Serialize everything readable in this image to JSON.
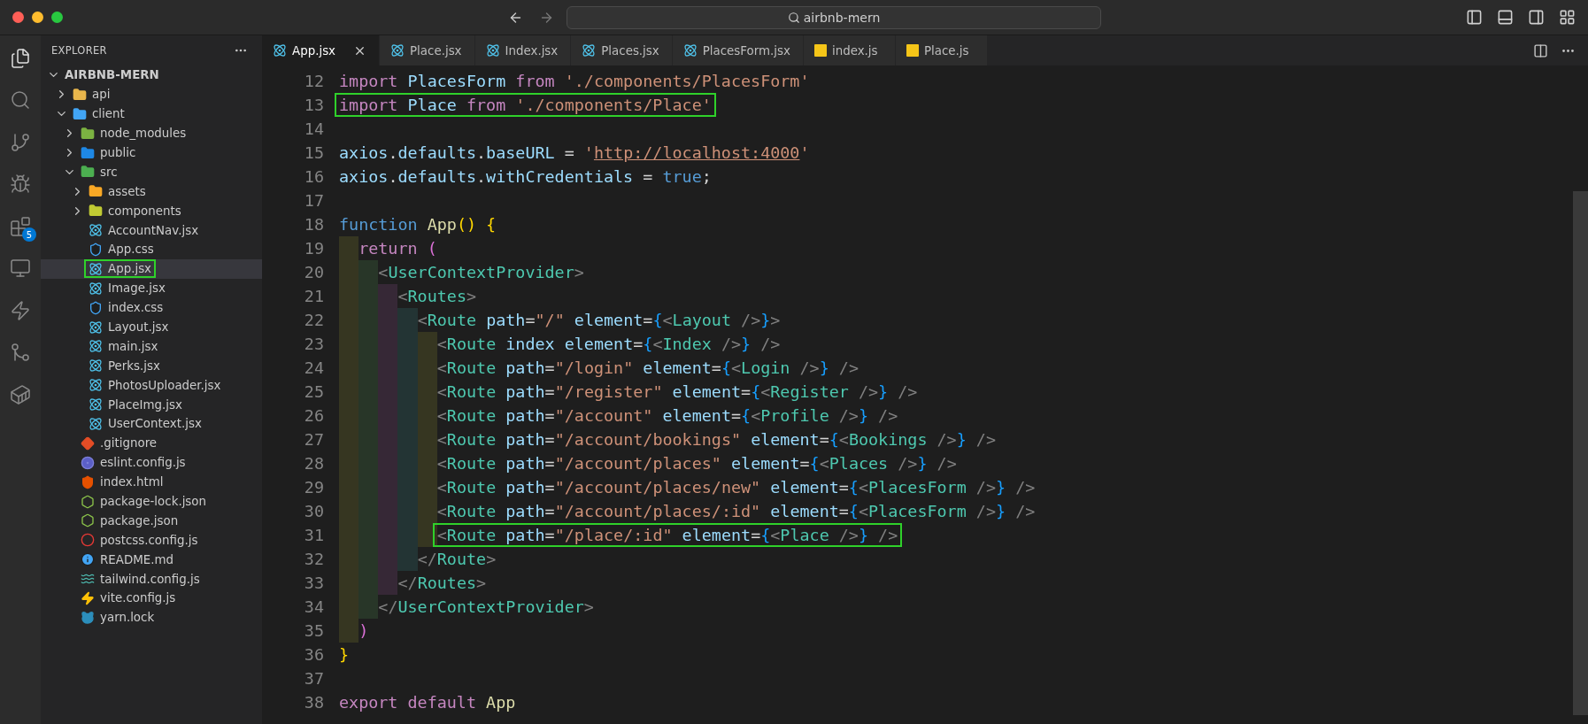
{
  "window": {
    "title": "airbnb-mern"
  },
  "activity_bar": [
    {
      "kind": "files",
      "selected": true
    },
    {
      "kind": "search",
      "selected": false
    },
    {
      "kind": "branch",
      "selected": false
    },
    {
      "kind": "debug",
      "selected": false
    },
    {
      "kind": "extensions",
      "selected": false,
      "badge": "5"
    },
    {
      "kind": "remote",
      "selected": false
    },
    {
      "kind": "lightning",
      "selected": false
    },
    {
      "kind": "merge",
      "selected": false
    },
    {
      "kind": "container",
      "selected": false
    }
  ],
  "explorer": {
    "title": "EXPLORER",
    "tree": [
      {
        "label": "AIRBNB-MERN",
        "kind": "root",
        "expanded": true,
        "selected": false,
        "boxed": false,
        "children": [
          {
            "label": "api",
            "kind": "folder",
            "color": "#e8b64c",
            "expanded": false,
            "selected": false,
            "boxed": false
          },
          {
            "label": "client",
            "kind": "folder",
            "color": "#42a5f5",
            "expanded": true,
            "selected": false,
            "boxed": false,
            "children": [
              {
                "label": "node_modules",
                "kind": "folder",
                "color": "#7cb342",
                "expanded": false,
                "selected": false,
                "boxed": false
              },
              {
                "label": "public",
                "kind": "folder",
                "color": "#1e88e5",
                "expanded": false,
                "selected": false,
                "boxed": false
              },
              {
                "label": "src",
                "kind": "folder",
                "color": "#4caf50",
                "expanded": true,
                "selected": false,
                "boxed": false,
                "children": [
                  {
                    "label": "assets",
                    "kind": "folder",
                    "color": "#f9a825",
                    "expanded": false,
                    "selected": false,
                    "boxed": false
                  },
                  {
                    "label": "components",
                    "kind": "folder",
                    "color": "#c0ca33",
                    "expanded": false,
                    "selected": false,
                    "boxed": false
                  },
                  {
                    "label": "AccountNav.jsx",
                    "kind": "react",
                    "selected": false,
                    "boxed": false
                  },
                  {
                    "label": "App.css",
                    "kind": "css",
                    "selected": false,
                    "boxed": false
                  },
                  {
                    "label": "App.jsx",
                    "kind": "react",
                    "selected": true,
                    "boxed": true
                  },
                  {
                    "label": "Image.jsx",
                    "kind": "react",
                    "selected": false,
                    "boxed": false
                  },
                  {
                    "label": "index.css",
                    "kind": "css",
                    "selected": false,
                    "boxed": false
                  },
                  {
                    "label": "Layout.jsx",
                    "kind": "react",
                    "selected": false,
                    "boxed": false
                  },
                  {
                    "label": "main.jsx",
                    "kind": "react",
                    "selected": false,
                    "boxed": false
                  },
                  {
                    "label": "Perks.jsx",
                    "kind": "react",
                    "selected": false,
                    "boxed": false
                  },
                  {
                    "label": "PhotosUploader.jsx",
                    "kind": "react",
                    "selected": false,
                    "boxed": false
                  },
                  {
                    "label": "PlaceImg.jsx",
                    "kind": "react",
                    "selected": false,
                    "boxed": false
                  },
                  {
                    "label": "UserContext.jsx",
                    "kind": "react",
                    "selected": false,
                    "boxed": false
                  }
                ]
              },
              {
                "label": ".gitignore",
                "kind": "git",
                "selected": false,
                "boxed": false
              },
              {
                "label": "eslint.config.js",
                "kind": "eslint",
                "selected": false,
                "boxed": false
              },
              {
                "label": "index.html",
                "kind": "html",
                "selected": false,
                "boxed": false
              },
              {
                "label": "package-lock.json",
                "kind": "json",
                "selected": false,
                "boxed": false
              },
              {
                "label": "package.json",
                "kind": "json",
                "selected": false,
                "boxed": false
              },
              {
                "label": "postcss.config.js",
                "kind": "postcss",
                "selected": false,
                "boxed": false
              },
              {
                "label": "README.md",
                "kind": "readme",
                "selected": false,
                "boxed": false
              },
              {
                "label": "tailwind.config.js",
                "kind": "tailwind",
                "selected": false,
                "boxed": false
              },
              {
                "label": "vite.config.js",
                "kind": "vite",
                "selected": false,
                "boxed": false
              },
              {
                "label": "yarn.lock",
                "kind": "yarn",
                "selected": false,
                "boxed": false
              }
            ]
          }
        ]
      }
    ]
  },
  "tabs": [
    {
      "label": "App.jsx",
      "kind": "react",
      "selected": true
    },
    {
      "label": "Place.jsx",
      "kind": "react",
      "selected": false
    },
    {
      "label": "Index.jsx",
      "kind": "react",
      "selected": false
    },
    {
      "label": "Places.jsx",
      "kind": "react",
      "selected": false
    },
    {
      "label": "PlacesForm.jsx",
      "kind": "react",
      "selected": false
    },
    {
      "label": "index.js",
      "kind": "js",
      "selected": false
    },
    {
      "label": "Place.js",
      "kind": "js",
      "selected": false
    }
  ],
  "editor": {
    "lines": [
      {
        "number": "12",
        "boxed": false,
        "tokens": [
          {
            "kind": "kw",
            "text": "import "
          },
          {
            "kind": "var",
            "text": "PlacesForm "
          },
          {
            "kind": "kw",
            "text": "from "
          },
          {
            "kind": "str",
            "text": "'./components/PlacesForm'"
          }
        ]
      },
      {
        "number": "13",
        "boxed": true,
        "tokens": [
          {
            "kind": "kw",
            "text": "import "
          },
          {
            "kind": "var",
            "text": "Place "
          },
          {
            "kind": "kw",
            "text": "from "
          },
          {
            "kind": "str",
            "text": "'./components/Place'"
          }
        ]
      },
      {
        "number": "14"
      },
      {
        "number": "15",
        "boxed": false,
        "tokens": [
          {
            "kind": "var",
            "text": "axios"
          },
          {
            "kind": "p",
            "text": "."
          },
          {
            "kind": "var",
            "text": "defaults"
          },
          {
            "kind": "p",
            "text": "."
          },
          {
            "kind": "var",
            "text": "baseURL"
          },
          {
            "kind": "p",
            "text": " = "
          },
          {
            "kind": "str",
            "text": "'"
          },
          {
            "kind": "link",
            "text": "http://localhost:4000"
          },
          {
            "kind": "str",
            "text": "'"
          }
        ]
      },
      {
        "number": "16",
        "boxed": false,
        "tokens": [
          {
            "kind": "var",
            "text": "axios"
          },
          {
            "kind": "p",
            "text": "."
          },
          {
            "kind": "var",
            "text": "defaults"
          },
          {
            "kind": "p",
            "text": "."
          },
          {
            "kind": "var",
            "text": "withCredentials"
          },
          {
            "kind": "p",
            "text": " = "
          },
          {
            "kind": "st",
            "text": "true"
          },
          {
            "kind": "p",
            "text": ";"
          }
        ]
      },
      {
        "number": "17"
      },
      {
        "number": "18",
        "boxed": false,
        "tokens": [
          {
            "kind": "st",
            "text": "function "
          },
          {
            "kind": "fn",
            "text": "App"
          },
          {
            "kind": "b1",
            "text": "() {"
          }
        ]
      },
      {
        "number": "19",
        "boxed": false,
        "tokens": [
          {
            "kind": "kw",
            "text": "  return "
          },
          {
            "kind": "b2",
            "text": "("
          }
        ]
      },
      {
        "number": "20",
        "boxed": false,
        "tokens": [
          {
            "kind": "ang",
            "text": "    <"
          },
          {
            "kind": "tag",
            "text": "UserContextProvider"
          },
          {
            "kind": "ang",
            "text": ">"
          }
        ]
      },
      {
        "number": "21",
        "boxed": false,
        "tokens": [
          {
            "kind": "ang",
            "text": "      <"
          },
          {
            "kind": "tag",
            "text": "Routes"
          },
          {
            "kind": "ang",
            "text": ">"
          }
        ]
      },
      {
        "number": "22",
        "boxed": false,
        "tokens": [
          {
            "kind": "ang",
            "text": "        <"
          },
          {
            "kind": "tag",
            "text": "Route "
          },
          {
            "kind": "attr",
            "text": "path"
          },
          {
            "kind": "p",
            "text": "="
          },
          {
            "kind": "str",
            "text": "\"/\" "
          },
          {
            "kind": "attr",
            "text": "element"
          },
          {
            "kind": "p",
            "text": "="
          },
          {
            "kind": "b3",
            "text": "{"
          },
          {
            "kind": "ang",
            "text": "<"
          },
          {
            "kind": "tag",
            "text": "Layout "
          },
          {
            "kind": "ang",
            "text": "/>"
          },
          {
            "kind": "b3",
            "text": "}"
          },
          {
            "kind": "ang",
            "text": ">"
          }
        ]
      },
      {
        "number": "23",
        "boxed": false,
        "tokens": [
          {
            "kind": "ang",
            "text": "          <"
          },
          {
            "kind": "tag",
            "text": "Route "
          },
          {
            "kind": "attr",
            "text": "index element"
          },
          {
            "kind": "p",
            "text": "="
          },
          {
            "kind": "b3",
            "text": "{"
          },
          {
            "kind": "ang",
            "text": "<"
          },
          {
            "kind": "tag",
            "text": "Index "
          },
          {
            "kind": "ang",
            "text": "/>"
          },
          {
            "kind": "b3",
            "text": "} "
          },
          {
            "kind": "ang",
            "text": "/>"
          }
        ]
      },
      {
        "number": "24",
        "boxed": false,
        "tokens": [
          {
            "kind": "ang",
            "text": "          <"
          },
          {
            "kind": "tag",
            "text": "Route "
          },
          {
            "kind": "attr",
            "text": "path"
          },
          {
            "kind": "p",
            "text": "="
          },
          {
            "kind": "str",
            "text": "\"/login\" "
          },
          {
            "kind": "attr",
            "text": "element"
          },
          {
            "kind": "p",
            "text": "="
          },
          {
            "kind": "b3",
            "text": "{"
          },
          {
            "kind": "ang",
            "text": "<"
          },
          {
            "kind": "tag",
            "text": "Login "
          },
          {
            "kind": "ang",
            "text": "/>"
          },
          {
            "kind": "b3",
            "text": "} "
          },
          {
            "kind": "ang",
            "text": "/>"
          }
        ]
      },
      {
        "number": "25",
        "boxed": false,
        "tokens": [
          {
            "kind": "ang",
            "text": "          <"
          },
          {
            "kind": "tag",
            "text": "Route "
          },
          {
            "kind": "attr",
            "text": "path"
          },
          {
            "kind": "p",
            "text": "="
          },
          {
            "kind": "str",
            "text": "\"/register\" "
          },
          {
            "kind": "attr",
            "text": "element"
          },
          {
            "kind": "p",
            "text": "="
          },
          {
            "kind": "b3",
            "text": "{"
          },
          {
            "kind": "ang",
            "text": "<"
          },
          {
            "kind": "tag",
            "text": "Register "
          },
          {
            "kind": "ang",
            "text": "/>"
          },
          {
            "kind": "b3",
            "text": "} "
          },
          {
            "kind": "ang",
            "text": "/>"
          }
        ]
      },
      {
        "number": "26",
        "boxed": false,
        "tokens": [
          {
            "kind": "ang",
            "text": "          <"
          },
          {
            "kind": "tag",
            "text": "Route "
          },
          {
            "kind": "attr",
            "text": "path"
          },
          {
            "kind": "p",
            "text": "="
          },
          {
            "kind": "str",
            "text": "\"/account\" "
          },
          {
            "kind": "attr",
            "text": "element"
          },
          {
            "kind": "p",
            "text": "="
          },
          {
            "kind": "b3",
            "text": "{"
          },
          {
            "kind": "ang",
            "text": "<"
          },
          {
            "kind": "tag",
            "text": "Profile "
          },
          {
            "kind": "ang",
            "text": "/>"
          },
          {
            "kind": "b3",
            "text": "} "
          },
          {
            "kind": "ang",
            "text": "/>"
          }
        ]
      },
      {
        "number": "27",
        "boxed": false,
        "tokens": [
          {
            "kind": "ang",
            "text": "          <"
          },
          {
            "kind": "tag",
            "text": "Route "
          },
          {
            "kind": "attr",
            "text": "path"
          },
          {
            "kind": "p",
            "text": "="
          },
          {
            "kind": "str",
            "text": "\"/account/bookings\" "
          },
          {
            "kind": "attr",
            "text": "element"
          },
          {
            "kind": "p",
            "text": "="
          },
          {
            "kind": "b3",
            "text": "{"
          },
          {
            "kind": "ang",
            "text": "<"
          },
          {
            "kind": "tag",
            "text": "Bookings "
          },
          {
            "kind": "ang",
            "text": "/>"
          },
          {
            "kind": "b3",
            "text": "} "
          },
          {
            "kind": "ang",
            "text": "/>"
          }
        ]
      },
      {
        "number": "28",
        "boxed": false,
        "tokens": [
          {
            "kind": "ang",
            "text": "          <"
          },
          {
            "kind": "tag",
            "text": "Route "
          },
          {
            "kind": "attr",
            "text": "path"
          },
          {
            "kind": "p",
            "text": "="
          },
          {
            "kind": "str",
            "text": "\"/account/places\" "
          },
          {
            "kind": "attr",
            "text": "element"
          },
          {
            "kind": "p",
            "text": "="
          },
          {
            "kind": "b3",
            "text": "{"
          },
          {
            "kind": "ang",
            "text": "<"
          },
          {
            "kind": "tag",
            "text": "Places "
          },
          {
            "kind": "ang",
            "text": "/>"
          },
          {
            "kind": "b3",
            "text": "} "
          },
          {
            "kind": "ang",
            "text": "/>"
          }
        ]
      },
      {
        "number": "29",
        "boxed": false,
        "tokens": [
          {
            "kind": "ang",
            "text": "          <"
          },
          {
            "kind": "tag",
            "text": "Route "
          },
          {
            "kind": "attr",
            "text": "path"
          },
          {
            "kind": "p",
            "text": "="
          },
          {
            "kind": "str",
            "text": "\"/account/places/new\" "
          },
          {
            "kind": "attr",
            "text": "element"
          },
          {
            "kind": "p",
            "text": "="
          },
          {
            "kind": "b3",
            "text": "{"
          },
          {
            "kind": "ang",
            "text": "<"
          },
          {
            "kind": "tag",
            "text": "PlacesForm "
          },
          {
            "kind": "ang",
            "text": "/>"
          },
          {
            "kind": "b3",
            "text": "} "
          },
          {
            "kind": "ang",
            "text": "/>"
          }
        ]
      },
      {
        "number": "30",
        "boxed": false,
        "tokens": [
          {
            "kind": "ang",
            "text": "          <"
          },
          {
            "kind": "tag",
            "text": "Route "
          },
          {
            "kind": "attr",
            "text": "path"
          },
          {
            "kind": "p",
            "text": "="
          },
          {
            "kind": "str",
            "text": "\"/account/places/:id\" "
          },
          {
            "kind": "attr",
            "text": "element"
          },
          {
            "kind": "p",
            "text": "="
          },
          {
            "kind": "b3",
            "text": "{"
          },
          {
            "kind": "ang",
            "text": "<"
          },
          {
            "kind": "tag",
            "text": "PlacesForm "
          },
          {
            "kind": "ang",
            "text": "/>"
          },
          {
            "kind": "b3",
            "text": "} "
          },
          {
            "kind": "ang",
            "text": "/>"
          }
        ]
      },
      {
        "number": "31",
        "boxed": true,
        "tokens": [
          {
            "kind": "ang",
            "text": "          <"
          },
          {
            "kind": "tag",
            "text": "Route "
          },
          {
            "kind": "attr",
            "text": "path"
          },
          {
            "kind": "p",
            "text": "="
          },
          {
            "kind": "str",
            "text": "\"/place/:id\" "
          },
          {
            "kind": "attr",
            "text": "element"
          },
          {
            "kind": "p",
            "text": "="
          },
          {
            "kind": "b3",
            "text": "{"
          },
          {
            "kind": "ang",
            "text": "<"
          },
          {
            "kind": "tag",
            "text": "Place "
          },
          {
            "kind": "ang",
            "text": "/>"
          },
          {
            "kind": "b3",
            "text": "} "
          },
          {
            "kind": "ang",
            "text": "/>"
          }
        ]
      },
      {
        "number": "32",
        "boxed": false,
        "tokens": [
          {
            "kind": "ang",
            "text": "        </"
          },
          {
            "kind": "tag",
            "text": "Route"
          },
          {
            "kind": "ang",
            "text": ">"
          }
        ]
      },
      {
        "number": "33",
        "boxed": false,
        "tokens": [
          {
            "kind": "ang",
            "text": "      </"
          },
          {
            "kind": "tag",
            "text": "Routes"
          },
          {
            "kind": "ang",
            "text": ">"
          }
        ]
      },
      {
        "number": "34",
        "boxed": false,
        "tokens": [
          {
            "kind": "ang",
            "text": "    </"
          },
          {
            "kind": "tag",
            "text": "UserContextProvider"
          },
          {
            "kind": "ang",
            "text": ">"
          }
        ]
      },
      {
        "number": "35",
        "boxed": false,
        "tokens": [
          {
            "kind": "b2",
            "text": "  )"
          }
        ]
      },
      {
        "number": "36",
        "boxed": false,
        "tokens": [
          {
            "kind": "b1",
            "text": "}"
          }
        ]
      },
      {
        "number": "37"
      },
      {
        "number": "38",
        "boxed": false,
        "tokens": [
          {
            "kind": "kw",
            "text": "export default "
          },
          {
            "kind": "fn",
            "text": "App"
          }
        ]
      }
    ]
  }
}
